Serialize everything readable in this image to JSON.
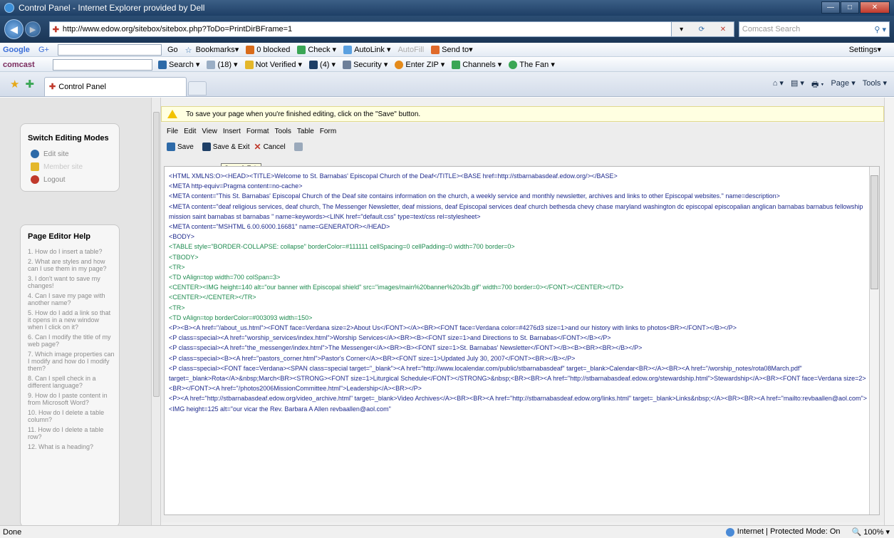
{
  "window": {
    "title": "Control Panel - Internet Explorer provided by Dell",
    "min": "—",
    "max": "□",
    "close": "✕"
  },
  "address": {
    "url": "http://www.edow.org/sitebox/sitebox.php?ToDo=PrintDirBFrame=1",
    "search_placeholder": "Comcast Search"
  },
  "toolbar_google": {
    "brand": "Google",
    "brand_suffix": "G+",
    "items": [
      "Go",
      "Bookmarks▾",
      "0 blocked",
      "Check ▾",
      "AutoLink ▾",
      "AutoFill",
      "Send to▾"
    ],
    "settings": "Settings▾"
  },
  "toolbar_comcast": {
    "brand": "comcast",
    "items": [
      "Search ▾",
      "(18) ▾",
      "Not Verified ▾",
      "(4) ▾",
      "Security ▾",
      "Enter ZIP ▾",
      "Channels ▾",
      "The Fan ▾"
    ]
  },
  "tab": {
    "label": "Control Panel"
  },
  "commandbar": {
    "items": [
      "⌂ ▾",
      "▤ ▾",
      "🖶 ▾",
      "Page ▾",
      "Tools ▾"
    ]
  },
  "infobar": {
    "text": "To save your page when you're finished editing, click on the \"Save\" button."
  },
  "leftpane": {
    "modes_title": "Switch Editing Modes",
    "modes": [
      "Edit site",
      "Member site",
      "Logout"
    ],
    "help_title": "Page Editor Help",
    "help_items": [
      "1. How do I insert a table?",
      "2. What are styles and how can I use them in my page?",
      "3. I don't want to save my changes!",
      "4. Can I save my page with another name?",
      "5. How do I add a link so that it opens in a new window when I click on it?",
      "6. Can I modify the title of my web page?",
      "7. Which image properties can I modify and how do I modify them?",
      "8. Can I spell check in a different language?",
      "9. How do I paste content in from Microsoft Word?",
      "10. How do I delete a table column?",
      "11. How do I delete a table row?",
      "12. What is a heading?"
    ]
  },
  "editor": {
    "menu": [
      "File",
      "Edit",
      "View",
      "Insert",
      "Format",
      "Tools",
      "Table",
      "Form"
    ],
    "save": "Save",
    "save_exit": "Save & Exit",
    "cancel": "Cancel",
    "tooltip": "Save & Exit",
    "code_lines": [
      {
        "c": "k",
        "t": "<HTML XMLNS:O><HEAD><TITLE>Welcome to St. Barnabas' Episcopal Church of the Deaf</TITLE><BASE href=http://stbarnabasdeaf.edow.org/></BASE>"
      },
      {
        "c": "k",
        "t": "<META http-equiv=Pragma content=no-cache>"
      },
      {
        "c": "k",
        "t": "<META content=\"This St. Barnabas' Episcopal Church of the Deaf site contains information on the church, a weekly service and monthly newsletter, archives and links to other Episcopal websites.\" name=description>"
      },
      {
        "c": "k",
        "t": "<META content=\"deaf religious services, deaf church, The Messenger Newsletter, deaf missions, deaf Episcopal services deaf church bethesda chevy chase maryland washington dc episcopal episcopalian anglican barnabas barnabus fellowship mission saint barnabas st barnabas \" name=keywords><LINK href=\"default.css\" type=text/css rel=stylesheet>"
      },
      {
        "c": "k",
        "t": "<META content=\"MSHTML 6.00.6000.16681\" name=GENERATOR></HEAD>"
      },
      {
        "c": "k",
        "t": "<BODY>"
      },
      {
        "c": "g",
        "t": "<TABLE style=\"BORDER-COLLAPSE: collapse\" borderColor=#111111 cellSpacing=0 cellPadding=0 width=700 border=0>"
      },
      {
        "c": "g",
        "t": "<TBODY>"
      },
      {
        "c": "g",
        "t": "<TR>"
      },
      {
        "c": "g",
        "t": "<TD vAlign=top width=700 colSpan=3>"
      },
      {
        "c": "g",
        "t": "<CENTER><IMG height=140 alt=\"our banner with Episcopal shield\" src=\"images/main%20banner%20x3b.gif\" width=700 border=0></FONT></CENTER></TD>"
      },
      {
        "c": "g",
        "t": "<CENTER></CENTER></TR>"
      },
      {
        "c": "g",
        "t": "<TR>"
      },
      {
        "c": "g",
        "t": "<TD vAlign=top borderColor=#003093 width=150>"
      },
      {
        "c": "k",
        "t": "<P><B><A href=\"/about_us.html\"><FONT face=Verdana size=2>About Us</FONT></A><BR><FONT face=Verdana color=#4276d3 size=1>and our history with links to photos<BR></FONT></B></P>"
      },
      {
        "c": "k",
        "t": "<P class=special><A href=\"worship_services/index.html\">Worship Services</A><BR><B><FONT size=1>and Directions to St. Barnabas</FONT></B></P>"
      },
      {
        "c": "k",
        "t": "<P class=special><A href=\"the_messenger/index.html\">The Messenger</A><BR><B><FONT size=1>St. Barnabas' Newsletter</FONT></B><B><BR><BR></B></P>"
      },
      {
        "c": "k",
        "t": "<P class=special><B><A href=\"pastors_corner.html\">Pastor's Corner</A><BR><FONT size=1>Updated July 30, 2007</FONT><BR></B></P>"
      },
      {
        "c": "k",
        "t": "<P class=special><FONT face=Verdana><SPAN class=special target=\"_blank\"><A href=\"http://www.localendar.com/public/stbarnabasdeaf\" target=_blank>Calendar<BR></A><BR><A href=\"/worship_notes/rota08March.pdf\" target=_blank>Rota</A>&nbsp;March<BR><STRONG><FONT size=1>Liturgical Schedule</FONT></STRONG>&nbsp;<BR><BR><A href=\"http://stbarnabasdeaf.edow.org/stewardship.html\">Stewardship</A><BR><FONT face=Verdana size=2><BR></FONT><A href=\"/photos2006MissionCommittee.html\">Leadership</A><BR></P>"
      },
      {
        "c": "k",
        "t": "<P><A href=\"http://stbarnabasdeaf.edow.org/video_archive.html\" target=_blank>Video Archives</A><BR><BR><A href=\"http://stbarnabasdeaf.edow.org/links.html\" target=_blank>Links&nbsp;</A><BR><BR><A href=\"mailto:revbaallen@aol.com\"><IMG height=125 alt=\"our vicar the Rev. Barbara A Allen revbaallen@aol.com\""
      }
    ]
  },
  "statusbar": {
    "left": "Done",
    "zone": "Internet | Protected Mode: On",
    "zoom": "100%"
  }
}
